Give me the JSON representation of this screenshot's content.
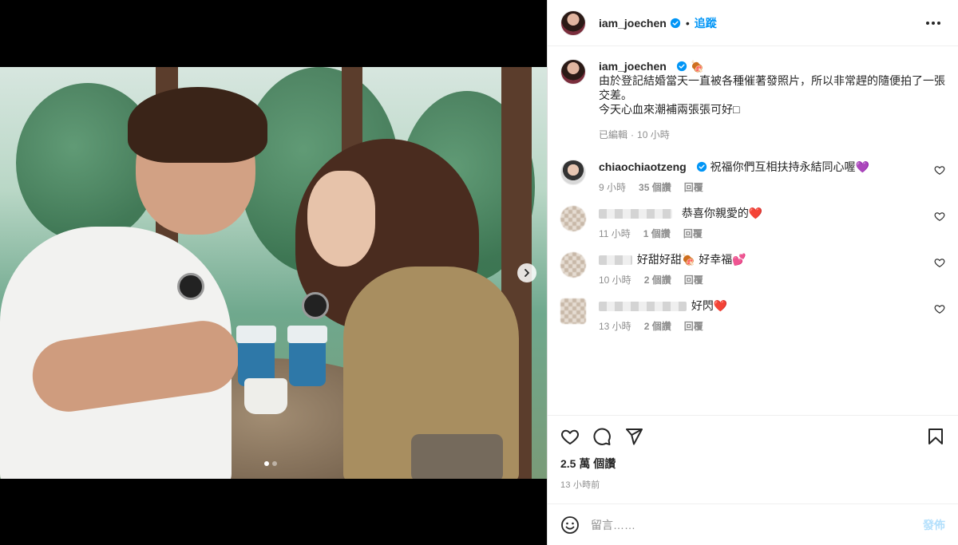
{
  "header": {
    "username": "iam_joechen",
    "separator": "•",
    "follow_label": "追蹤"
  },
  "caption": {
    "username": "iam_joechen",
    "emoji": "🍖",
    "line1": "由於登記結婚當天一直被各種催著發照片，所以非常趕的隨便拍了一張交差。",
    "line2": "今天心血來潮補兩張張可好□",
    "edited": "已編輯",
    "dot": "·",
    "time": "10 小時"
  },
  "comments": [
    {
      "username": "chiaochiaotzeng",
      "text": "祝福你們互相扶持永結同心喔💜",
      "time": "9 小時",
      "likes": "35 個讚",
      "reply": "回覆",
      "blurred": false
    },
    {
      "username": "",
      "text": "恭喜你親愛的❤️",
      "time": "11 小時",
      "likes": "1 個讚",
      "reply": "回覆",
      "blurred": true
    },
    {
      "username": "",
      "text": "好甜好甜🍖 好幸福💕",
      "time": "10 小時",
      "likes": "2 個讚",
      "reply": "回覆",
      "blurred": true
    },
    {
      "username": "",
      "text": "好閃❤️",
      "time": "13 小時",
      "likes": "2 個讚",
      "reply": "回覆",
      "blurred": true
    }
  ],
  "stats": {
    "views": "2.5 萬 個讚",
    "posted": "13 小時前"
  },
  "composer": {
    "placeholder": "留言……",
    "post_label": "發佈"
  },
  "colors": {
    "accent": "#0095f6",
    "muted": "#8e8e8e",
    "text": "#262626",
    "post_disabled": "#b2dffc"
  },
  "carousel": {
    "total": 2,
    "current": 1
  }
}
